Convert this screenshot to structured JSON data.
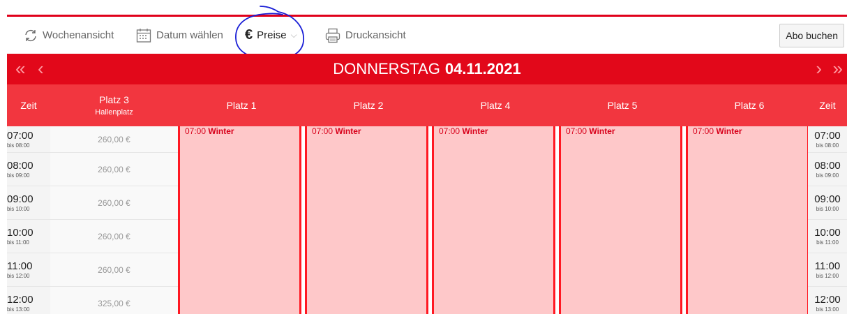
{
  "toolbar": {
    "week_view": "Wochenansicht",
    "pick_date": "Datum wählen",
    "prices": "Preise",
    "print_view": "Druckansicht",
    "subscribe": "Abo buchen"
  },
  "date_bar": {
    "weekday": "DONNERSTAG",
    "date": "04.11.2021"
  },
  "columns": {
    "time_left": "Zeit",
    "court3": "Platz 3",
    "court3_sub": "Hallenplatz",
    "court1": "Platz 1",
    "court2": "Platz 2",
    "court4": "Platz 4",
    "court5": "Platz 5",
    "court6": "Platz 6",
    "time_right": "Zeit"
  },
  "slots": [
    {
      "time": "07:00",
      "until": "bis 08:00",
      "price": "260,00 €"
    },
    {
      "time": "08:00",
      "until": "bis 09:00",
      "price": "260,00 €"
    },
    {
      "time": "09:00",
      "until": "bis 10:00",
      "price": "260,00 €"
    },
    {
      "time": "10:00",
      "until": "bis 11:00",
      "price": "260,00 €"
    },
    {
      "time": "11:00",
      "until": "bis 12:00",
      "price": "260,00 €"
    },
    {
      "time": "12:00",
      "until": "bis 13:00",
      "price": "325,00 €"
    }
  ],
  "booking": {
    "time": "07:00",
    "name": "Winter"
  },
  "colors": {
    "brand_red": "#e2081a",
    "header_red": "#f2363f",
    "booked_fill": "#fec8c9",
    "annotation": "#1a1fd6"
  }
}
